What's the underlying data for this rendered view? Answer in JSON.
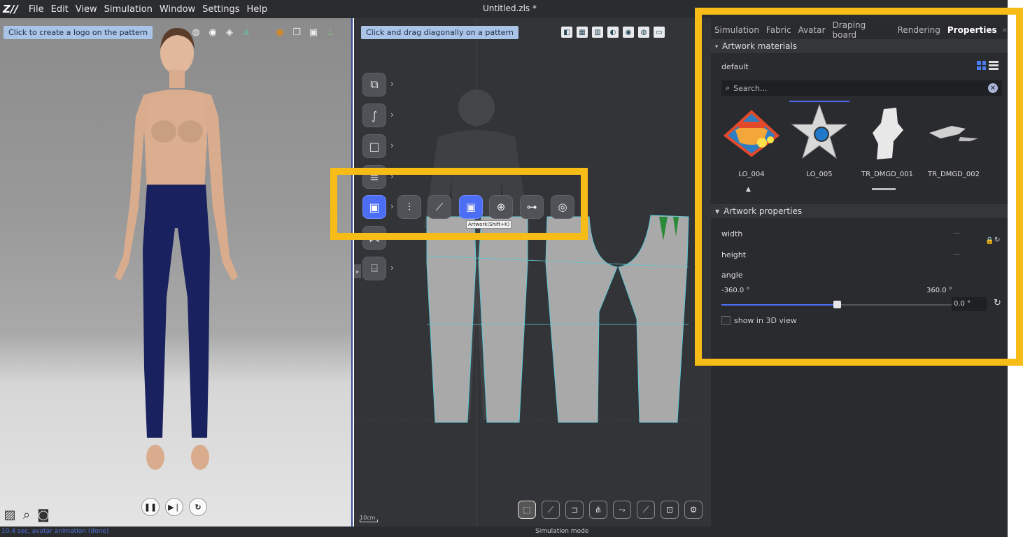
{
  "app": {
    "logo": "Z//",
    "document_title": "Untitled.zls *"
  },
  "menu": [
    "File",
    "Edit",
    "View",
    "Simulation",
    "Window",
    "Settings",
    "Help"
  ],
  "view3d": {
    "hint": "Click to create a logo on the pattern",
    "bottom_icons": [
      "screenshot-icon",
      "zoom-icon",
      "camera-icon"
    ],
    "playback": [
      "pause-icon",
      "step-forward-icon",
      "reset-icon"
    ]
  },
  "view2d": {
    "hint": "Click and drag diagonally on a pattern",
    "tooltip": "Artwork(Shift+K)",
    "scale_label": "10cm"
  },
  "panel": {
    "tabs": [
      "Simulation",
      "Fabric",
      "Avatar",
      "Draping board",
      "Rendering",
      "Properties"
    ],
    "active_tab": "Properties",
    "close_glyph": "×",
    "section_materials": "Artwork materials",
    "library_name": "default",
    "search_placeholder": "Search...",
    "artworks": [
      {
        "label": "LO_004"
      },
      {
        "label": "LO_005"
      },
      {
        "label": "TR_DMGD_001"
      },
      {
        "label": "TR_DMGD_002"
      }
    ],
    "section_properties": "Artwork properties",
    "width_label": "width",
    "height_label": "height",
    "dash": "—",
    "angle_label": "angle",
    "angle_min": "-360.0 °",
    "angle_max": "360.0 °",
    "angle_value": "0.0 °",
    "angle_fraction": 0.5,
    "show_3d_label": "show in 3D view"
  },
  "status": {
    "left": "10.4 sec, avatar animation (done)",
    "center": "Simulation mode"
  },
  "colors": {
    "highlight": "#f7bc16",
    "accent": "#4c6ef5",
    "jeans": "#19225e"
  }
}
